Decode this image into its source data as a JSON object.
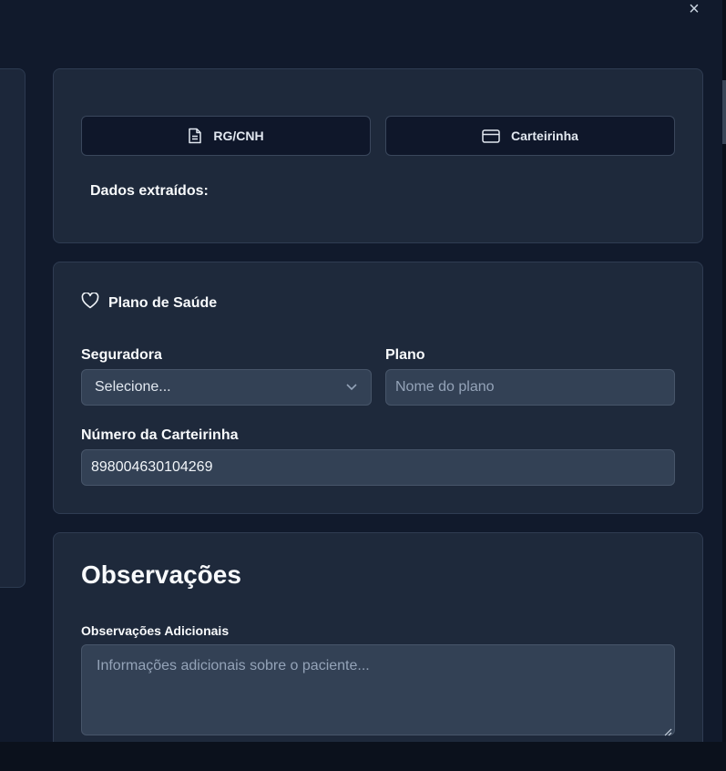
{
  "window": {
    "close_label": "×"
  },
  "documents": {
    "rg_button_label": "RG/CNH",
    "card_button_label": "Carteirinha",
    "extracted_label": "Dados extraídos:"
  },
  "health_plan": {
    "title": "Plano de Saúde",
    "insurer_label": "Seguradora",
    "insurer_selected": "Selecione...",
    "plan_label": "Plano",
    "plan_placeholder": "Nome do plano",
    "card_number_label": "Número da Carteirinha",
    "card_number_value": "898004630104269"
  },
  "observations": {
    "title": "Observações",
    "additional_label": "Observações Adicionais",
    "additional_placeholder": "Informações adicionais sobre o paciente..."
  },
  "icons": {
    "rg": "file-text-icon",
    "card": "credit-card-icon",
    "plan": "heart-icon",
    "select": "chevron-down-icon",
    "close": "close-icon"
  },
  "colors": {
    "background": "#111a2c",
    "card": "#1e293b",
    "input": "#334155",
    "button": "#0f172a"
  }
}
